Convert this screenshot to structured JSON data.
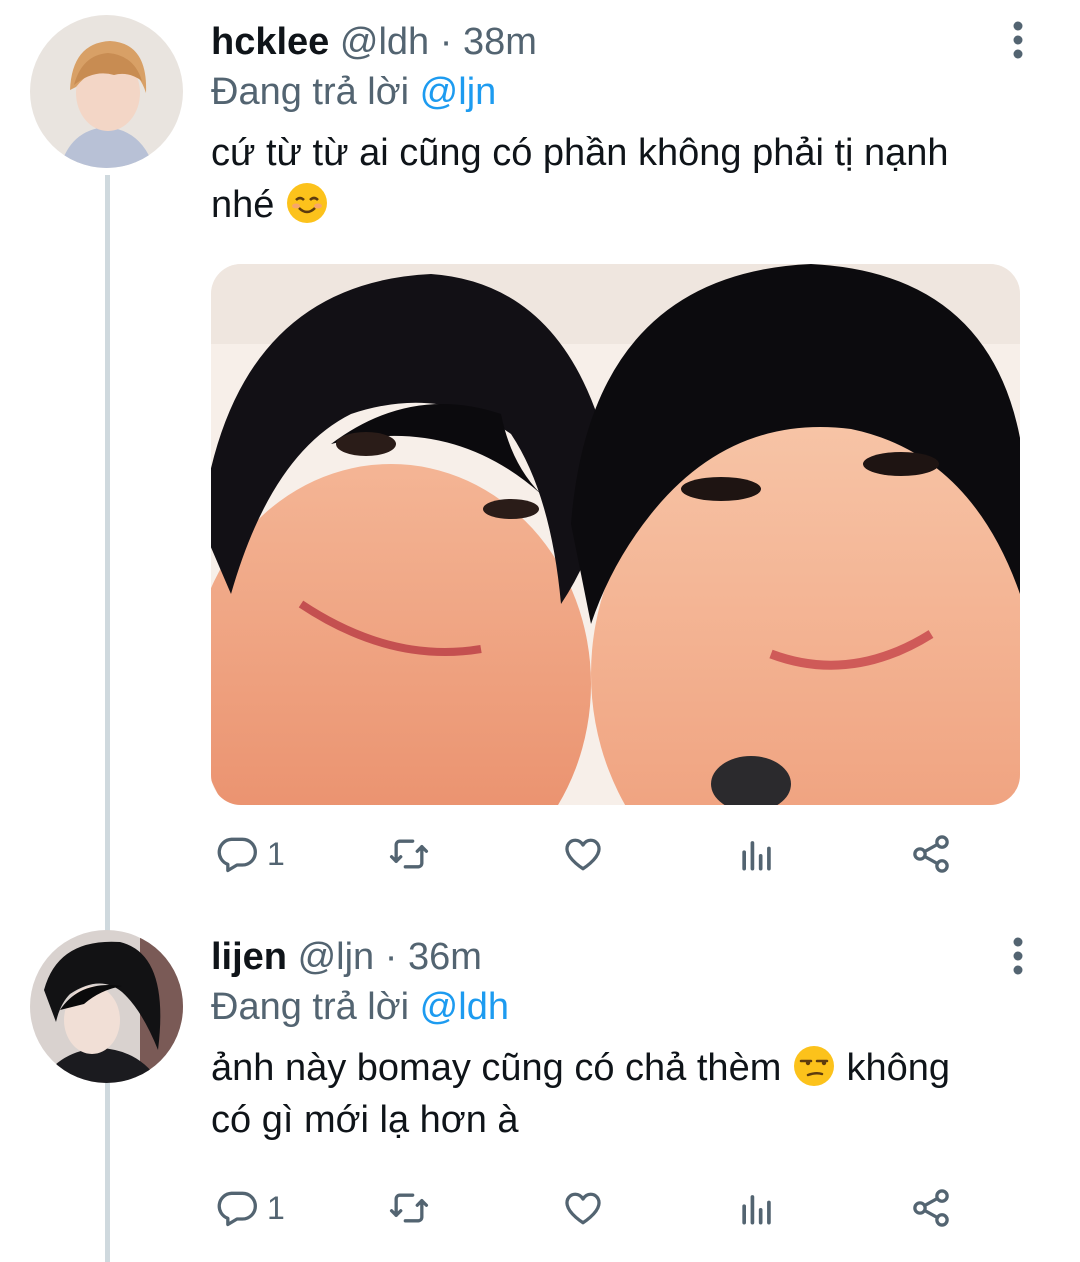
{
  "tweets": [
    {
      "name": "hcklee",
      "handle": "@ldh",
      "separator": "·",
      "time": "38m",
      "replying_prefix": "Đang trả lời",
      "replying_to": "@ljn",
      "text_line1": "cứ từ từ ai cũng có phần không phải tị nạnh",
      "text_line2": "nhé",
      "emoji": "smiling-face-with-smiling-eyes",
      "has_media": true,
      "actions": {
        "reply_count": "1"
      }
    },
    {
      "name": "lijen",
      "handle": "@ljn",
      "separator": "·",
      "time": "36m",
      "replying_prefix": "Đang trả lời",
      "replying_to": "@ldh",
      "text_line1_a": "ảnh này bomay cũng có chả thèm",
      "text_line1_b": "không",
      "text_line2": "có gì mới lạ hơn à",
      "emoji": "unamused-face",
      "actions": {
        "reply_count": "1"
      }
    }
  ],
  "colors": {
    "accent": "#1d9bf0",
    "muted": "#536471",
    "text": "#0f1419",
    "thread": "#cfd9de"
  }
}
